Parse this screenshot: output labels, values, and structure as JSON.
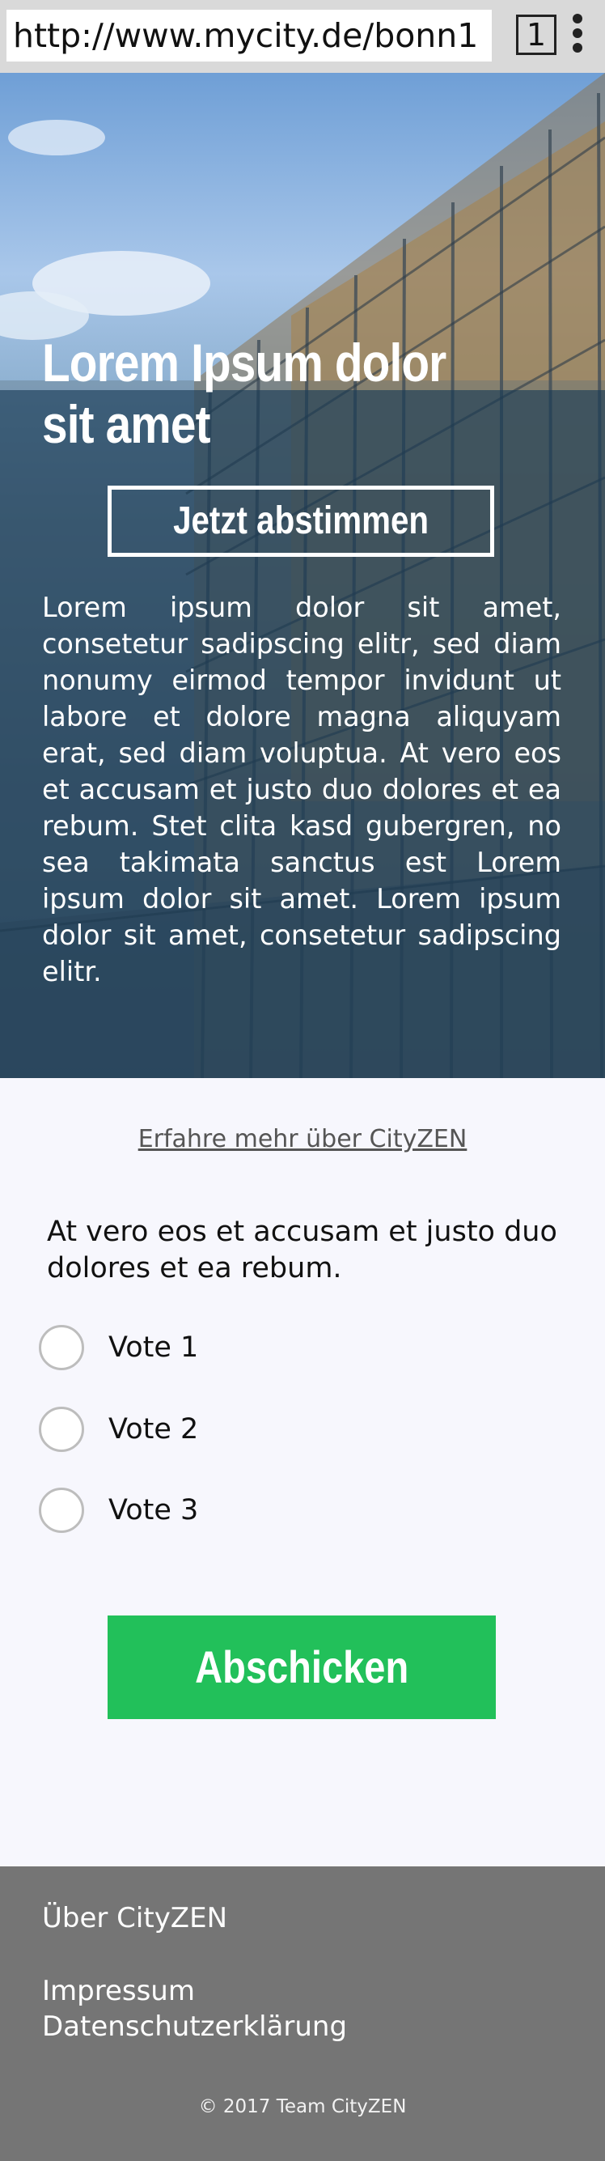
{
  "browser": {
    "url": "http://www.mycity.de/bonn1",
    "tab_count": "1"
  },
  "hero": {
    "title": "Lorem Ipsum dolor sit amet",
    "vote_now_label": "Jetzt abstimmen",
    "text": "Lorem ipsum dolor sit amet, consetetur sadipscing elitr, sed diam nonumy eirmod tempor invidunt ut labore et dolore magna aliquyam erat, sed diam voluptua. At vero eos et accusam et justo duo dolores et ea rebum. Stet clita kasd gubergren, no sea takimata sanctus est Lorem ipsum dolor sit amet. Lorem ipsum dolor sit amet, consetetur sadipscing elitr."
  },
  "content": {
    "learn_more_link": "Erfahre mehr über CityZEN",
    "question": "At vero eos et accusam et justo duo dolores et ea rebum.",
    "options": [
      {
        "label": "Vote 1"
      },
      {
        "label": "Vote 2"
      },
      {
        "label": "Vote 3"
      }
    ],
    "submit_label": "Abschicken"
  },
  "footer": {
    "links": [
      {
        "label": "Über CityZEN"
      },
      {
        "label": "Impressum"
      },
      {
        "label": "Datenschutzerklärung"
      }
    ],
    "copyright": "© 2017 Team CityZEN"
  },
  "colors": {
    "accent_green": "#22c05a",
    "footer_gray": "#757575",
    "hero_overlay": "#163a56",
    "page_background": "#f7f7fd"
  },
  "icons": {
    "menu": "more-vertical-icon",
    "tabs": "tab-switcher-icon"
  }
}
